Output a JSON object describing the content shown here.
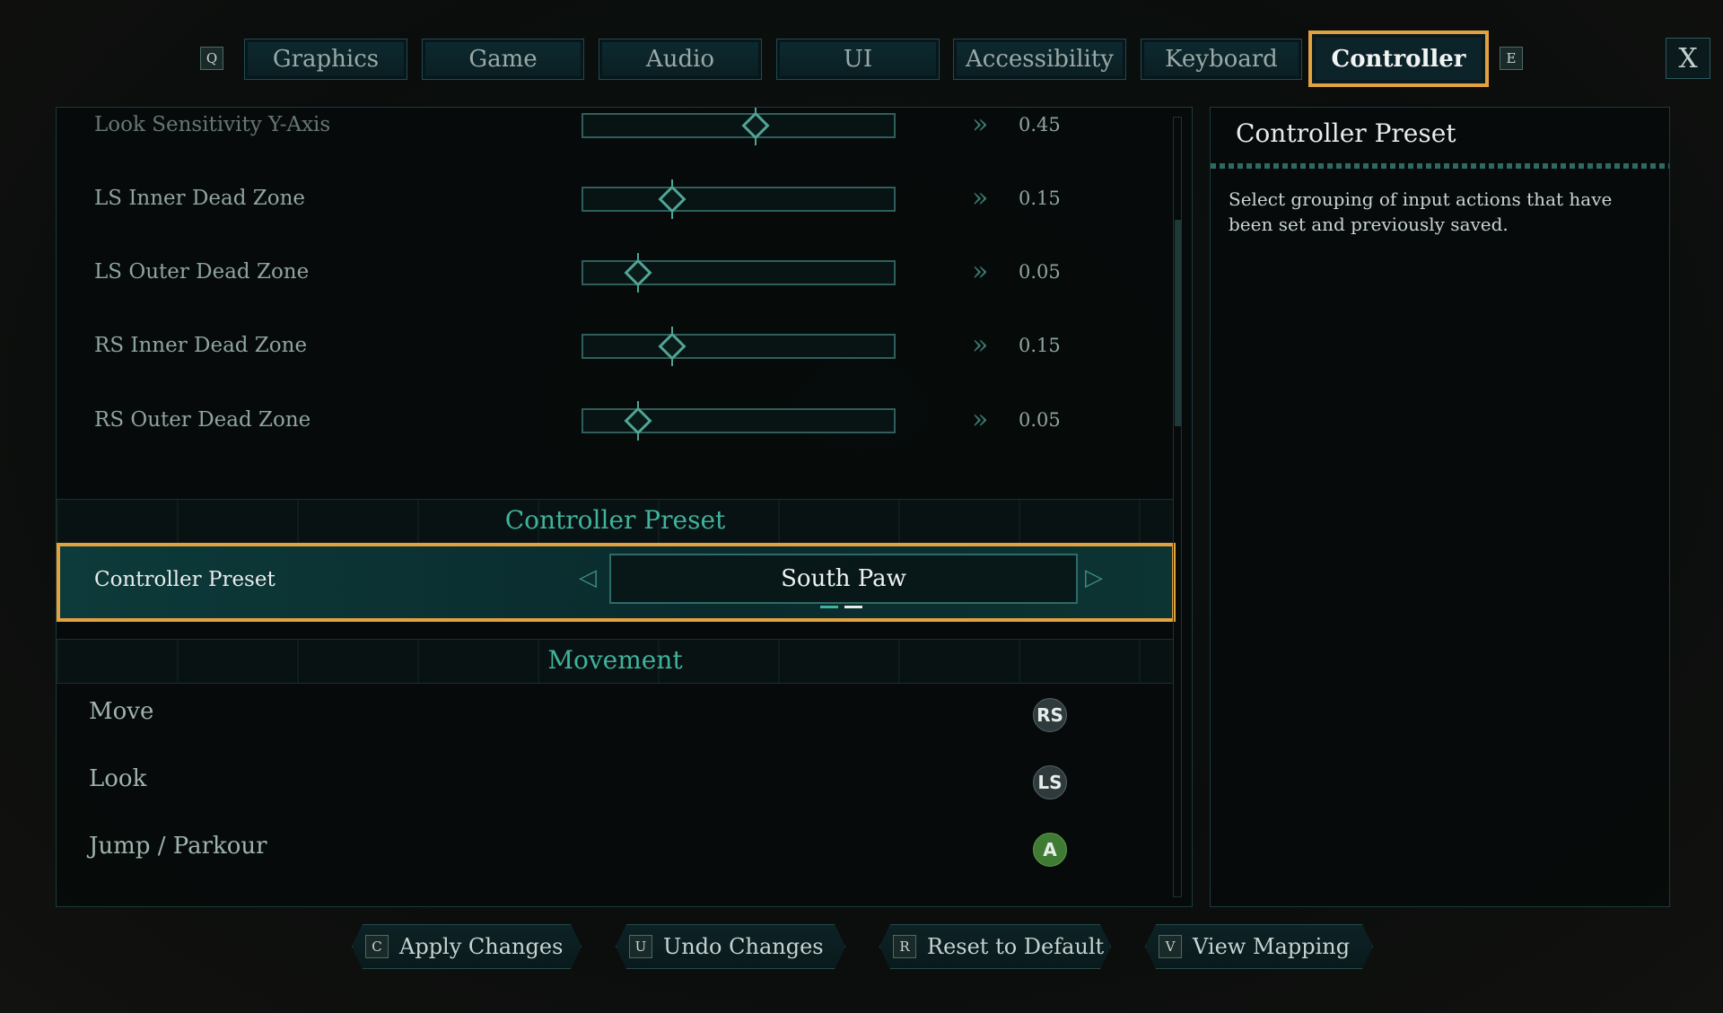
{
  "tabs": {
    "prev_key": "Q",
    "next_key": "E",
    "items": [
      "Graphics",
      "Game",
      "Audio",
      "UI",
      "Accessibility",
      "Keyboard",
      "Controller"
    ],
    "active": "Controller"
  },
  "close_label": "X",
  "sliders": [
    {
      "label": "Look Sensitivity Y-Axis",
      "value": "0.45",
      "fraction": 0.45
    },
    {
      "label": "LS Inner Dead Zone",
      "value": "0.15",
      "fraction": 0.15
    },
    {
      "label": "LS Outer Dead Zone",
      "value": "0.05",
      "fraction": 0.05
    },
    {
      "label": "RS Inner Dead Zone",
      "value": "0.15",
      "fraction": 0.15
    },
    {
      "label": "RS Outer Dead Zone",
      "value": "0.05",
      "fraction": 0.05
    }
  ],
  "preset_section": {
    "title": "Controller Preset",
    "row_label": "Controller Preset",
    "value": "South Paw"
  },
  "movement_section": {
    "title": "Movement",
    "bindings": [
      {
        "action": "Move",
        "button": "RS"
      },
      {
        "action": "Look",
        "button": "LS"
      },
      {
        "action": "Jump / Parkour",
        "button": "A"
      }
    ]
  },
  "info_panel": {
    "title": "Controller Preset",
    "description": "Select grouping of input actions that have been set and previously saved."
  },
  "footer": [
    {
      "key": "C",
      "label": "Apply Changes"
    },
    {
      "key": "U",
      "label": "Undo Changes"
    },
    {
      "key": "R",
      "label": "Reset to Default"
    },
    {
      "key": "V",
      "label": "View Mapping"
    }
  ],
  "colors": {
    "accent": "#e3a240",
    "teal": "#3fb39d",
    "panel_border": "#1b3a3a"
  }
}
